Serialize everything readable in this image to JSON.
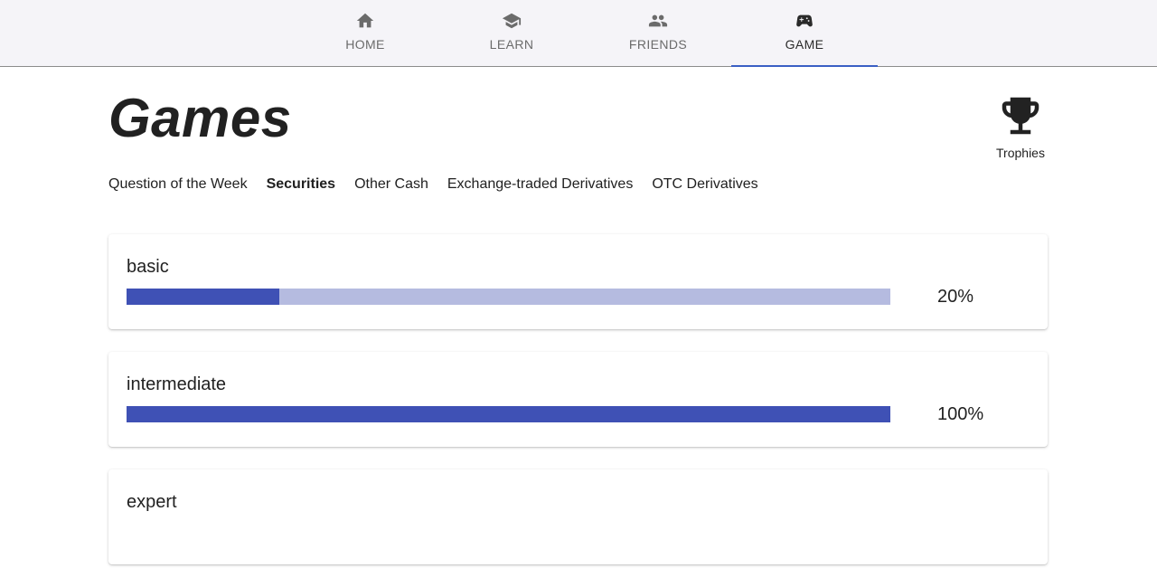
{
  "nav": {
    "tabs": [
      {
        "label": "HOME",
        "icon": "home-icon",
        "active": false
      },
      {
        "label": "LEARN",
        "icon": "school-icon",
        "active": false
      },
      {
        "label": "FRIENDS",
        "icon": "people-icon",
        "active": false
      },
      {
        "label": "GAME",
        "icon": "gamepad-icon",
        "active": true
      }
    ],
    "accent_color": "#3a5fc4"
  },
  "header": {
    "title": "Games",
    "trophies_label": "Trophies",
    "trophies_icon": "trophy-icon"
  },
  "categories": {
    "items": [
      {
        "label": "Question of the Week",
        "active": false
      },
      {
        "label": "Securities",
        "active": true
      },
      {
        "label": "Other Cash",
        "active": false
      },
      {
        "label": "Exchange-traded Derivatives",
        "active": false
      },
      {
        "label": "OTC Derivatives",
        "active": false
      }
    ]
  },
  "levels": [
    {
      "name": "basic",
      "progress": 0.2,
      "percent_label": "20%"
    },
    {
      "name": "intermediate",
      "progress": 1.0,
      "percent_label": "100%"
    },
    {
      "name": "expert"
    }
  ],
  "colors": {
    "progress_fill": "#3f51b5",
    "progress_track": "#b5bbe0"
  }
}
